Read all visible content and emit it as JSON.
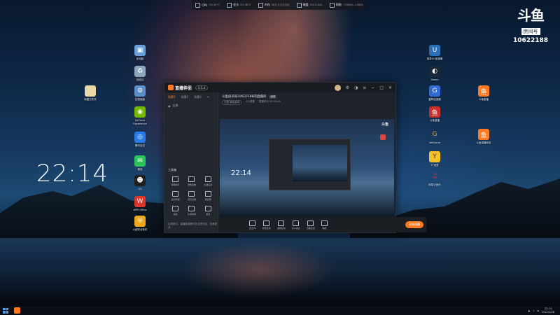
{
  "stats": [
    {
      "label": "CPU",
      "value": "0% 45°C"
    },
    {
      "label": "显卡",
      "value": "5% 48°C"
    },
    {
      "label": "内存",
      "value": "26% 5.2G/16G"
    },
    {
      "label": "磁盘",
      "value": "0% 0.1K/s"
    },
    {
      "label": "网络",
      "value": "↑256B/s  ↓1KB/s"
    }
  ],
  "douyu": {
    "logo": "斗鱼",
    "sub": "房间号",
    "room": "10622188"
  },
  "clock": "22:14",
  "desktop_left": [
    {
      "name": "此电脑",
      "icon": "computer-icon",
      "color": "#6aa0d8"
    },
    {
      "name": "回收站",
      "icon": "recycle-bin-icon",
      "color": "#8fa5bb"
    },
    {
      "name": "控制面板",
      "icon": "control-panel-icon",
      "color": "#5a8fc9"
    },
    {
      "name": "GeForce Experience",
      "icon": "nvidia-icon",
      "color": "#76b900"
    },
    {
      "name": "腾讯会议",
      "icon": "meeting-icon",
      "color": "#2a7be4"
    },
    {
      "name": "微信",
      "icon": "wechat-icon",
      "color": "#2ec25a"
    },
    {
      "name": "QQ",
      "icon": "qq-icon",
      "color": "#1f1f1f"
    },
    {
      "name": "WPS Office",
      "icon": "wps-icon",
      "color": "#d9352a"
    },
    {
      "name": "火绒安全软件",
      "icon": "shield-icon",
      "color": "#f0a61c"
    }
  ],
  "desktop_file": {
    "name": "新建文件夹",
    "icon": "folder-icon",
    "color": "#e8d8a8"
  },
  "desktop_right": [
    {
      "name": "网易UU加速器",
      "icon": "uu-icon",
      "color": "#2b6fb6"
    },
    {
      "name": "Steam",
      "icon": "steam-icon",
      "color": "#1b2838"
    },
    {
      "name": "雷神加速器",
      "icon": "accelerator-icon",
      "color": "#2f6bd3"
    },
    {
      "name": "斗鱼直播",
      "icon": "douyu-icon",
      "color": "#ff7a22"
    },
    {
      "name": "WeGame",
      "icon": "wegame-icon",
      "color": "#e9a13a"
    },
    {
      "name": "斗鱼直播伴侣",
      "icon": "douyu-companion-icon",
      "color": "#ff7a22"
    },
    {
      "name": "YY语音",
      "icon": "yy-icon",
      "color": "#f5c12a"
    },
    {
      "name": "网易云音乐",
      "icon": "music-icon",
      "color": "#e2352b"
    }
  ],
  "app": {
    "logo": "直播伴侣",
    "version": "5.5.4",
    "side_tabs": [
      "场景1",
      "场景2",
      "场景3"
    ],
    "side_row": "全屏",
    "tools_label": "工具箱",
    "tools": [
      "弹幕助手",
      "录像回放",
      "主播任务",
      "房间管理",
      "音乐点歌",
      "粉丝团",
      "抽奖",
      "礼物特效",
      "更多"
    ],
    "footer": "礼物提示、直播数据等可在这里开启，查看更多",
    "room_title": "斗鱼房间号10622188的直播间",
    "room_tag": "编辑",
    "meta": [
      "分类 单机游戏",
      "0人观看",
      "直播时长 00:00:00"
    ],
    "bottom_items": [
      "连麦PK",
      "视频连线",
      "语音互动",
      "多人连麦",
      "直播设置",
      "美颜"
    ],
    "go_live": "开始直播"
  },
  "taskbar": {
    "time": "22:14",
    "date": "2022/2/28"
  }
}
